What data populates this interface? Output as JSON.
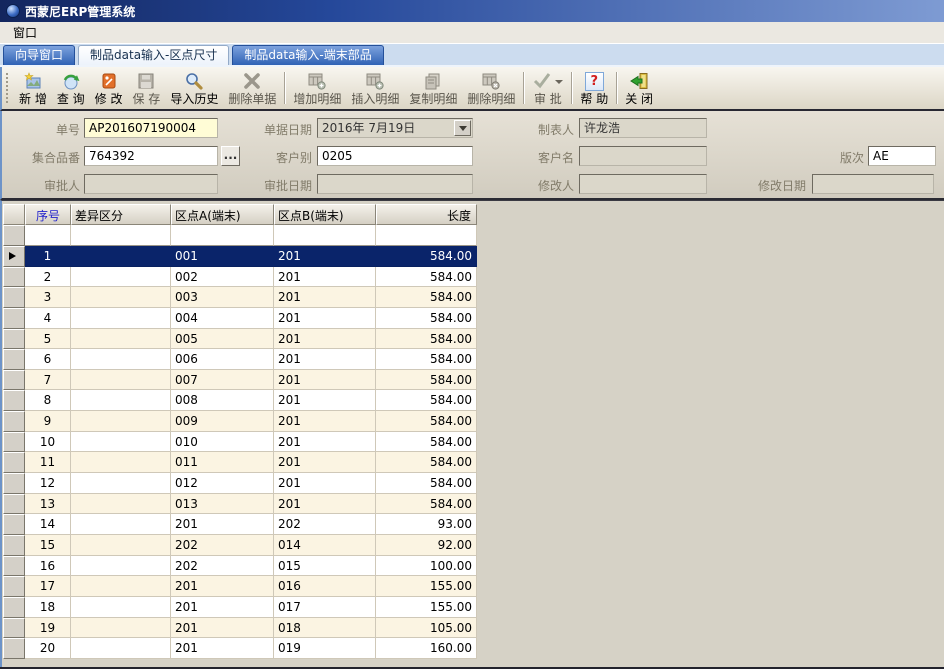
{
  "window": {
    "title": "西蒙尼ERP管理系统",
    "menu_items": [
      {
        "label": "窗口"
      }
    ]
  },
  "tabs": [
    {
      "label": "向导窗口",
      "active": false
    },
    {
      "label": "制品data输入-区点尺寸",
      "active": true
    },
    {
      "label": "制品data输入-端末部品",
      "active": false
    }
  ],
  "toolbar": {
    "buttons": [
      {
        "id": "new",
        "label": "新 增",
        "enabled": true
      },
      {
        "id": "query",
        "label": "查 询",
        "enabled": true
      },
      {
        "id": "modify",
        "label": "修 改",
        "enabled": true
      },
      {
        "id": "save",
        "label": "保 存",
        "enabled": false
      },
      {
        "id": "import-history",
        "label": "导入历史",
        "enabled": true
      },
      {
        "id": "delete-doc",
        "label": "删除单据",
        "enabled": false
      },
      {
        "id": "add-detail",
        "label": "增加明细",
        "enabled": false
      },
      {
        "id": "insert-detail",
        "label": "插入明细",
        "enabled": false
      },
      {
        "id": "copy-detail",
        "label": "复制明细",
        "enabled": false
      },
      {
        "id": "remove-detail",
        "label": "删除明细",
        "enabled": false
      },
      {
        "id": "approve",
        "label": "审 批",
        "enabled": false
      },
      {
        "id": "help",
        "label": "帮 助",
        "enabled": true
      },
      {
        "id": "close",
        "label": "关 闭",
        "enabled": true
      }
    ]
  },
  "form": {
    "doc_no": {
      "label": "单号",
      "value": "AP201607190004"
    },
    "doc_date": {
      "label": "单据日期",
      "value": "2016年 7月19日"
    },
    "preparer": {
      "label": "制表人",
      "value": "许龙浩"
    },
    "part_group_no": {
      "label": "集合品番",
      "value": "764392",
      "browse_label": "..."
    },
    "customer_type": {
      "label": "客户别",
      "value": "0205"
    },
    "customer_name": {
      "label": "客户名",
      "value": ""
    },
    "revision": {
      "label": "版次",
      "value": "AE"
    },
    "approver": {
      "label": "审批人",
      "value": ""
    },
    "approve_date": {
      "label": "审批日期",
      "value": ""
    },
    "modifier": {
      "label": "修改人",
      "value": ""
    },
    "modify_date": {
      "label": "修改日期",
      "value": ""
    }
  },
  "table": {
    "headers": [
      "序号",
      "差异区分",
      "区点A(端末)",
      "区点B(端末)",
      "长度"
    ],
    "selected_row_index": 0,
    "rows": [
      {
        "seq": "1",
        "diff": "",
        "point_a": "001",
        "point_b": "201",
        "length": "584.00"
      },
      {
        "seq": "2",
        "diff": "",
        "point_a": "002",
        "point_b": "201",
        "length": "584.00"
      },
      {
        "seq": "3",
        "diff": "",
        "point_a": "003",
        "point_b": "201",
        "length": "584.00"
      },
      {
        "seq": "4",
        "diff": "",
        "point_a": "004",
        "point_b": "201",
        "length": "584.00"
      },
      {
        "seq": "5",
        "diff": "",
        "point_a": "005",
        "point_b": "201",
        "length": "584.00"
      },
      {
        "seq": "6",
        "diff": "",
        "point_a": "006",
        "point_b": "201",
        "length": "584.00"
      },
      {
        "seq": "7",
        "diff": "",
        "point_a": "007",
        "point_b": "201",
        "length": "584.00"
      },
      {
        "seq": "8",
        "diff": "",
        "point_a": "008",
        "point_b": "201",
        "length": "584.00"
      },
      {
        "seq": "9",
        "diff": "",
        "point_a": "009",
        "point_b": "201",
        "length": "584.00"
      },
      {
        "seq": "10",
        "diff": "",
        "point_a": "010",
        "point_b": "201",
        "length": "584.00"
      },
      {
        "seq": "11",
        "diff": "",
        "point_a": "011",
        "point_b": "201",
        "length": "584.00"
      },
      {
        "seq": "12",
        "diff": "",
        "point_a": "012",
        "point_b": "201",
        "length": "584.00"
      },
      {
        "seq": "13",
        "diff": "",
        "point_a": "013",
        "point_b": "201",
        "length": "584.00"
      },
      {
        "seq": "14",
        "diff": "",
        "point_a": "201",
        "point_b": "202",
        "length": "93.00"
      },
      {
        "seq": "15",
        "diff": "",
        "point_a": "202",
        "point_b": "014",
        "length": "92.00"
      },
      {
        "seq": "16",
        "diff": "",
        "point_a": "202",
        "point_b": "015",
        "length": "100.00"
      },
      {
        "seq": "17",
        "diff": "",
        "point_a": "201",
        "point_b": "016",
        "length": "155.00"
      },
      {
        "seq": "18",
        "diff": "",
        "point_a": "201",
        "point_b": "017",
        "length": "155.00"
      },
      {
        "seq": "19",
        "diff": "",
        "point_a": "201",
        "point_b": "018",
        "length": "105.00"
      },
      {
        "seq": "20",
        "diff": "",
        "point_a": "201",
        "point_b": "019",
        "length": "160.00"
      }
    ]
  },
  "colors": {
    "selected_row": "#0a246a",
    "row_alternate": "#fbf4e2",
    "doc_no_field": "#fffcd6",
    "titlebar_left": "#13265e",
    "titlebar_right": "#7e9bd3",
    "seq_header_text": "#2323cc"
  }
}
